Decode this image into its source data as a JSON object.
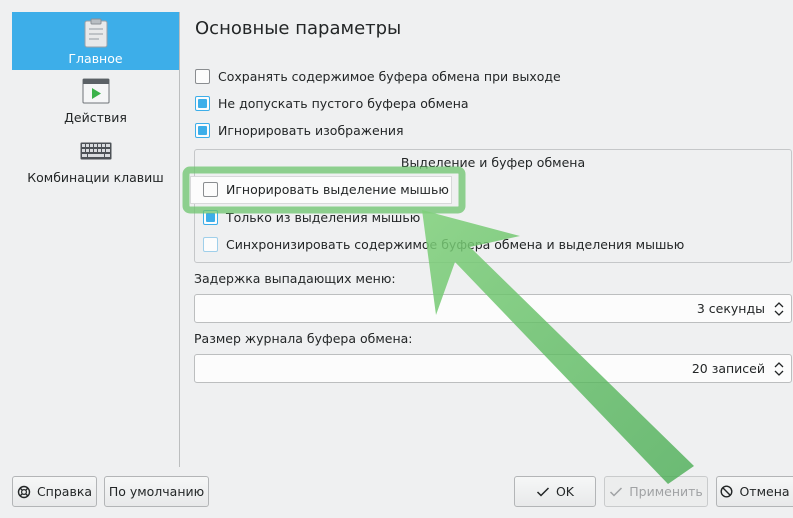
{
  "sidebar": {
    "items": [
      {
        "label": "Главное",
        "icon": "clipboard-icon",
        "active": true
      },
      {
        "label": "Действия",
        "icon": "play-window-icon",
        "active": false
      },
      {
        "label": "Комбинации клавиш",
        "icon": "keyboard-icon",
        "active": false
      }
    ]
  },
  "main": {
    "title": "Основные параметры",
    "options": [
      {
        "label": "Сохранять содержимое буфера обмена при выходе",
        "checked": false
      },
      {
        "label": "Не допускать пустого буфера обмена",
        "checked": true
      },
      {
        "label": "Игнорировать изображения",
        "checked": true
      }
    ],
    "group": {
      "title": "Выделение и буфер обмена",
      "options": [
        {
          "label": "Игнорировать выделение мышью",
          "checked": false
        },
        {
          "label": "Только из выделения мышью",
          "checked": true
        },
        {
          "label": "Синхронизировать содержимое буфера обмена и выделения мышью",
          "checked": false,
          "disabled": true
        }
      ]
    },
    "popup_delay": {
      "label": "Задержка выпадающих меню:",
      "value": "3 секунды"
    },
    "history_size": {
      "label": "Размер журнала буфера обмена:",
      "value": "20 записей"
    }
  },
  "buttons": {
    "help": "Справка",
    "defaults": "По умолчанию",
    "ok": "OK",
    "apply": "Применить",
    "cancel": "Отмена"
  },
  "colors": {
    "accent": "#3daee9",
    "annotation_arrow": "#5cbf5c"
  }
}
